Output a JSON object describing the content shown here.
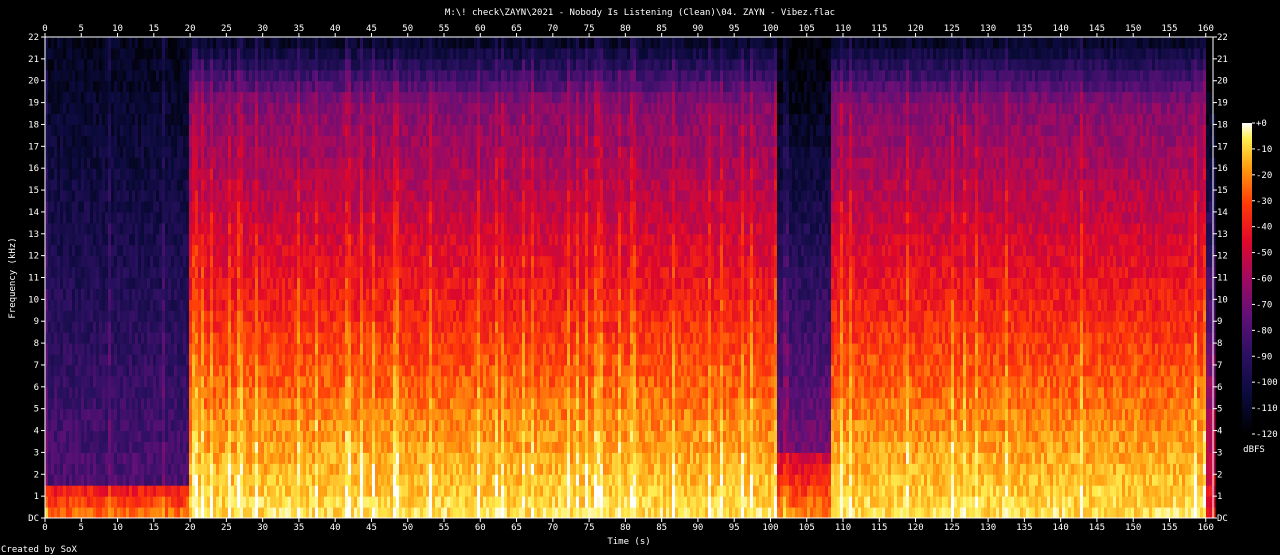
{
  "chart_data": {
    "type": "heatmap",
    "title": "M:\\! check\\ZAYN\\2021 - Nobody Is Listening (Clean)\\04. ZAYN - Vibez.flac",
    "xlabel": "Time (s)",
    "ylabel": "Frequency (kHz)",
    "xlim": [
      0,
      161
    ],
    "ylim": [
      0,
      22
    ],
    "x_ticks": [
      "0",
      "5",
      "10",
      "15",
      "20",
      "25",
      "30",
      "35",
      "40",
      "45",
      "50",
      "55",
      "60",
      "65",
      "70",
      "75",
      "80",
      "85",
      "90",
      "95",
      "100",
      "105",
      "110",
      "115",
      "120",
      "125",
      "130",
      "135",
      "140",
      "145",
      "150",
      "155",
      "160"
    ],
    "y_ticks": [
      "DC",
      "1",
      "2",
      "3",
      "4",
      "5",
      "6",
      "7",
      "8",
      "9",
      "10",
      "11",
      "12",
      "13",
      "14",
      "15",
      "16",
      "17",
      "18",
      "19",
      "20",
      "21",
      "22"
    ],
    "colorbar": {
      "label": "dBFS",
      "range": [
        -120,
        0
      ],
      "ticks": [
        "+0",
        "-10",
        "-20",
        "-30",
        "-40",
        "-50",
        "-60",
        "-70",
        "-80",
        "-90",
        "-100",
        "-110",
        "-120"
      ]
    },
    "segments": [
      {
        "start": 0,
        "end": 19.5,
        "description": "quiet intro, energy mostly below 1.5 kHz"
      },
      {
        "start": 19.5,
        "end": 100.5,
        "description": "full band content up to ~20 kHz"
      },
      {
        "start": 100.5,
        "end": 108,
        "description": "breakdown, energy mostly below 4 kHz"
      },
      {
        "start": 108,
        "end": 160,
        "description": "full band content up to ~20 kHz"
      },
      {
        "start": 160,
        "end": 161,
        "description": "fade out"
      }
    ],
    "footer": "Created by SoX"
  }
}
